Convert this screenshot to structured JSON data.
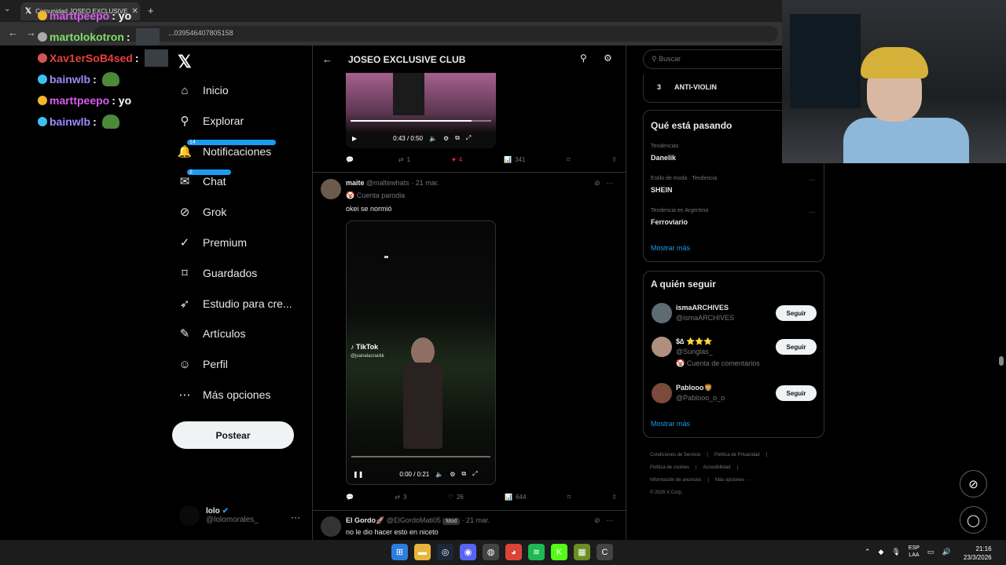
{
  "browser": {
    "tab_title": "Comunidad JOSEO EXCLUSIVE",
    "url": "x.com/i/communities/1903954640780515 8",
    "url_visible": "...039546407805158"
  },
  "stream_chat": [
    {
      "user": "marttpeepo",
      "text": ": yo",
      "color": "#d85cf0",
      "badge_color": "#f5b62b"
    },
    {
      "user": "martolokotron",
      "text": ":",
      "color": "#7fe06a",
      "badge_color": "#aaaaaa"
    },
    {
      "user": "Xav1erSoB4sed",
      "text": ":",
      "color": "#e8403d",
      "badge_color": "#d45757"
    },
    {
      "user": "bainwlb",
      "text": ":",
      "color": "#9b8cff",
      "badge_color": "#3ec0f0"
    },
    {
      "user": "marttpeepo",
      "text": ": yo",
      "color": "#d85cf0",
      "badge_color": "#f5b62b"
    },
    {
      "user": "bainwlb",
      "text": ":",
      "color": "#9b8cff",
      "badge_color": "#3ec0f0"
    }
  ],
  "x_logo": "𝕏",
  "nav": {
    "items": [
      {
        "label": "Inicio",
        "icon": "home-icon",
        "glyph": "⌂"
      },
      {
        "label": "Explorar",
        "icon": "search-icon",
        "glyph": "⚲"
      },
      {
        "label": "Notificaciones",
        "icon": "bell-icon",
        "glyph": "🔔",
        "badge": "14"
      },
      {
        "label": "Chat",
        "icon": "mail-icon",
        "glyph": "✉",
        "badge": "2"
      },
      {
        "label": "Grok",
        "icon": "grok-icon",
        "glyph": "⊘"
      },
      {
        "label": "Premium",
        "icon": "verified-icon",
        "glyph": "✓"
      },
      {
        "label": "Guardados",
        "icon": "bookmark-icon",
        "glyph": "⌑"
      },
      {
        "label": "Estudio para cre...",
        "icon": "rocket-icon",
        "glyph": "➶"
      },
      {
        "label": "Artículos",
        "icon": "article-icon",
        "glyph": "✎"
      },
      {
        "label": "Perfil",
        "icon": "person-icon",
        "glyph": "☺"
      },
      {
        "label": "Más opciones",
        "icon": "more-circle-icon",
        "glyph": "⋯"
      }
    ],
    "post_button": "Postear",
    "account_name": "lolo",
    "account_handle": "@lolomorales_"
  },
  "community": {
    "title": "JOSEO EXCLUSIVE CLUB"
  },
  "post1": {
    "video_time": "0:43 / 0:50",
    "progress": 0.86,
    "replies": "",
    "reposts": "1",
    "likes": "4",
    "views": "341"
  },
  "post2": {
    "name": "maite",
    "handle": "@maltewhats",
    "date": "· 21 mar.",
    "label": "🤡 Cuenta parodia",
    "text": "okei se normió",
    "watermark_brand": "TikTok",
    "watermark_user": "@juanalacrackk",
    "video_time": "0:00 / 0:21",
    "progress": 0.0,
    "reposts": "3",
    "likes": "26",
    "views": "644"
  },
  "post3": {
    "name": "El Gordo🚀",
    "handle": "@ElGordoMati05",
    "badge": "Mod",
    "date": "· 21 mar.",
    "text": "no le dio hacer esto en niceto"
  },
  "right": {
    "search_placeholder": "Buscar",
    "top_item_rank": "3",
    "top_item_name": "ANTI-VIOLIN",
    "trends_title": "Qué está pasando",
    "trends": [
      {
        "category": "Tendencias",
        "name": "Danelik"
      },
      {
        "category": "Estilo de moda · Tendencia",
        "name": "SHEIN"
      },
      {
        "category": "Tendencia en Argentina",
        "name": "Ferroviario"
      }
    ],
    "show_more": "Mostrar más",
    "follow_title": "A quién seguir",
    "follow": [
      {
        "name": "ismaARCHIVES",
        "handle": "@ismaARCHIVES",
        "extra": ""
      },
      {
        "name": "$∆ ⭐⭐⭐",
        "handle": "@Sunglas_",
        "extra": "🤡 Cuenta de comentarios"
      },
      {
        "name": "Pablooo🦁",
        "handle": "@Pablooo_o_o",
        "extra": ""
      }
    ],
    "follow_button": "Seguir",
    "show_more_2": "Mostrar más",
    "footer": [
      "Condiciones de Servicio",
      "|",
      "Política de Privacidad",
      "|",
      "Política de cookies",
      "|",
      "Accesibilidad",
      "|",
      "Información de anuncios",
      "|",
      "Más opciones ···",
      "© 2026 X Corp."
    ]
  },
  "taskbar": {
    "lang_top": "ESP",
    "lang_bottom": "LAA",
    "time": "21:16",
    "date": "23/3/2026"
  }
}
